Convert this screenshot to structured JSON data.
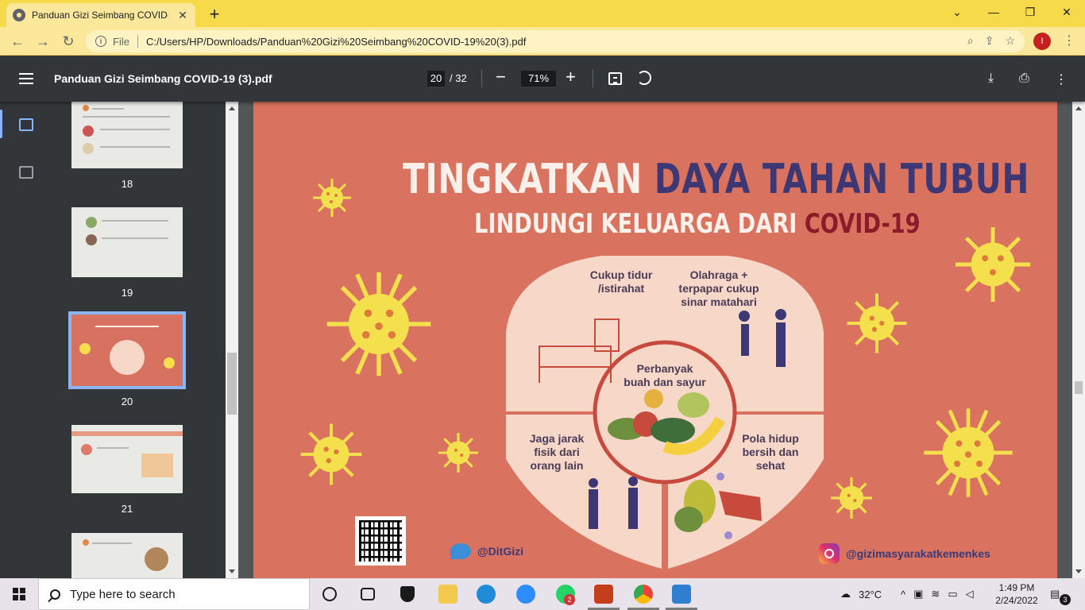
{
  "browser": {
    "tab_title": "Panduan Gizi Seimbang COVID-1",
    "url_scheme_label": "File",
    "url": "C:/Users/HP/Downloads/Panduan%20Gizi%20Seimbang%20COVID-19%20(3).pdf",
    "profile_initial": "I"
  },
  "pdf_toolbar": {
    "title": "Panduan Gizi Seimbang COVID-19 (3).pdf",
    "current_page": "20",
    "total_pages": "/ 32",
    "zoom": "71%"
  },
  "thumbnails": [
    {
      "label": "18"
    },
    {
      "label": "19"
    },
    {
      "label": "20"
    },
    {
      "label": "21"
    }
  ],
  "poster": {
    "title_white": "TINGKATKAN",
    "title_navy": "DAYA TAHAN TUBUH",
    "subtitle_white": "LINDUNGI KELUARGA DARI",
    "subtitle_red": "COVID-19",
    "tip_sleep": "Cukup tidur\n/istirahat",
    "tip_exercise": "Olahraga +\nterpapar cukup\nsinar matahari",
    "tip_food": "Perbanyak\nbuah dan sayur",
    "tip_distance": "Jaga jarak\nfisik dari\norang lain",
    "tip_clean": "Pola hidup\nbersih dan\nsehat",
    "twitter": "@DitGizi",
    "instagram": "@gizimasyarakatkemenkes",
    "colors": {
      "background": "#d9735f",
      "navy": "#3d3873",
      "red": "#8a1b2b",
      "virus": "#f4e04d",
      "plate": "#f6d7c8"
    }
  },
  "taskbar": {
    "search_placeholder": "Type here to search",
    "whatsapp_badge": "2",
    "notification_count": "3",
    "temperature": "32°C",
    "time": "1:49 PM",
    "date": "2/24/2022"
  }
}
